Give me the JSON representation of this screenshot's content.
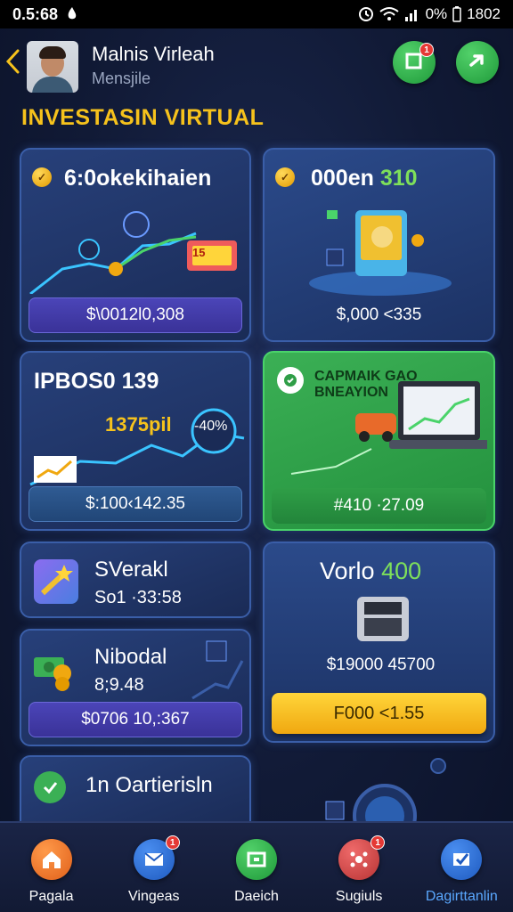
{
  "status_bar": {
    "time": "0.5:68",
    "battery_text": "0%",
    "clock": "1802"
  },
  "header": {
    "name": "Malnis Virleah",
    "subtitle": "Mensjile",
    "notif_count": "1"
  },
  "section_title": "INVESTASIN VIRTUAL",
  "cards": {
    "c1": {
      "title": "6:0okekihaien",
      "amount": "$\\0012l0,308",
      "chip_label": "15"
    },
    "c2": {
      "title": "000en",
      "title_accent": "310",
      "amount": "$,000 <335"
    },
    "c3": {
      "title": "IPBOS0 139",
      "value": "1375pil",
      "percent": "-40%",
      "amount": "$:100‹142.35"
    },
    "c4": {
      "title_line1": "CAPMAIK GAO",
      "title_line2": "BNEAYION",
      "amount": "#410 ·27.09"
    },
    "c5": {
      "title": "SVerakl",
      "sub": "So1 ·33:58"
    },
    "c6": {
      "title": "Vorlo",
      "title_accent": "400",
      "value": "$19000 45700",
      "button": "F000 <1.55"
    },
    "c7": {
      "title": "Nibodal",
      "sub": "8;9.48",
      "amount": "$0706 10,:367"
    },
    "c8": {
      "title": "1n Oartierisln"
    }
  },
  "nav": {
    "items": [
      {
        "label": "Pagala",
        "icon": "home-icon"
      },
      {
        "label": "Vingeas",
        "icon": "mail-icon",
        "badge": "1"
      },
      {
        "label": "Daeich",
        "icon": "chat-icon"
      },
      {
        "label": "Sugiuls",
        "icon": "network-icon",
        "badge": "1"
      },
      {
        "label": "Dagirttanlin",
        "icon": "check-icon",
        "active": true
      }
    ]
  },
  "colors": {
    "accent_yellow": "#f6c21c",
    "accent_green": "#3bb055",
    "nav_active": "#5aa8ff"
  }
}
